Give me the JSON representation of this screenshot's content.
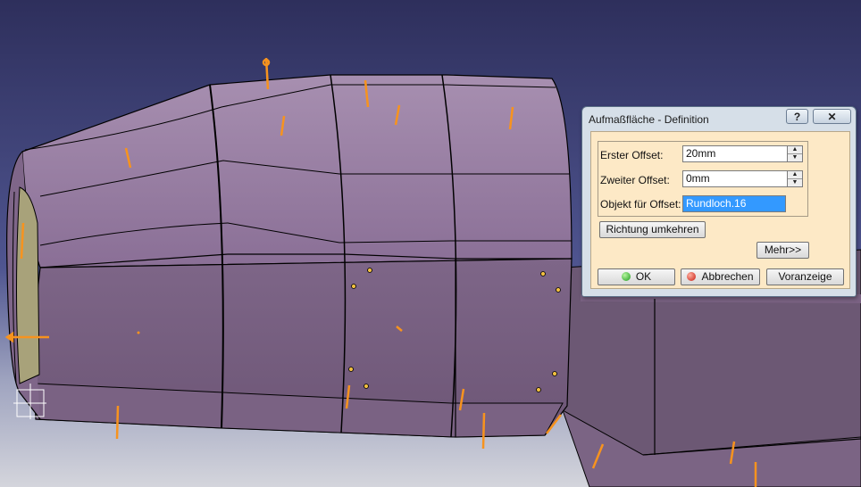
{
  "dialog": {
    "title": "Aufmaßfläche - Definition",
    "help_label": "?",
    "close_label": "✕",
    "first_offset_label": "Erster Offset:",
    "first_offset_value": "20mm",
    "second_offset_label": "Zweiter Offset:",
    "second_offset_value": "0mm",
    "object_label": "Objekt für Offset:",
    "object_value": "Rundloch.16",
    "reverse_button": "Richtung umkehren",
    "more_button": "Mehr>>",
    "ok_button": "OK",
    "cancel_button": "Abbrechen",
    "preview_button": "Voranzeige"
  },
  "colors": {
    "background": "#3a3a6a",
    "surface": "#8a6e94",
    "direction_arrows": "#f7931e",
    "dialog_body": "#fde9c6"
  }
}
